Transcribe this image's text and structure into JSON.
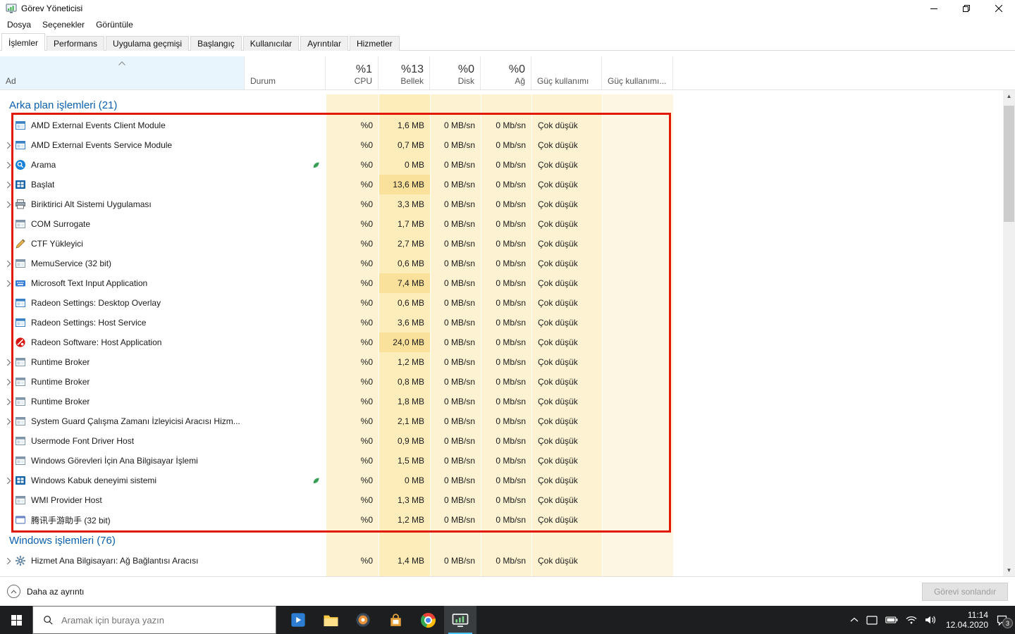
{
  "window": {
    "title": "Görev Yöneticisi"
  },
  "menu": [
    "Dosya",
    "Seçenekler",
    "Görüntüle"
  ],
  "tabs": [
    {
      "label": "İşlemler",
      "active": true
    },
    {
      "label": "Performans",
      "active": false
    },
    {
      "label": "Uygulama geçmişi",
      "active": false
    },
    {
      "label": "Başlangıç",
      "active": false
    },
    {
      "label": "Kullanıcılar",
      "active": false
    },
    {
      "label": "Ayrıntılar",
      "active": false
    },
    {
      "label": "Hizmetler",
      "active": false
    }
  ],
  "columns": {
    "name": {
      "label": "Ad",
      "sort": "asc"
    },
    "status": {
      "label": "Durum"
    },
    "cpu": {
      "total": "%1",
      "label": "CPU"
    },
    "memory": {
      "total": "%13",
      "label": "Bellek"
    },
    "disk": {
      "total": "%0",
      "label": "Disk"
    },
    "network": {
      "total": "%0",
      "label": "Ağ"
    },
    "power": {
      "label": "Güç kullanımı"
    },
    "power_trend": {
      "label": "Güç kullanımı..."
    }
  },
  "groups": {
    "background": "Arka plan işlemleri (21)",
    "windows": "Windows işlemleri (76)"
  },
  "background_processes": [
    {
      "icon": "app-window",
      "name": "AMD External Events Client Module",
      "cpu": "%0",
      "memory": "1,6 MB",
      "disk": "0 MB/sn",
      "network": "0 Mb/sn",
      "power": "Çok düşük",
      "expandable": false,
      "suspended": false
    },
    {
      "icon": "app-window",
      "name": "AMD External Events Service Module",
      "cpu": "%0",
      "memory": "0,7 MB",
      "disk": "0 MB/sn",
      "network": "0 Mb/sn",
      "power": "Çok düşük",
      "expandable": true,
      "suspended": false
    },
    {
      "icon": "search",
      "name": "Arama",
      "cpu": "%0",
      "memory": "0 MB",
      "disk": "0 MB/sn",
      "network": "0 Mb/sn",
      "power": "Çok düşük",
      "expandable": true,
      "suspended": true
    },
    {
      "icon": "start",
      "name": "Başlat",
      "cpu": "%0",
      "memory": "13,6 MB",
      "disk": "0 MB/sn",
      "network": "0 Mb/sn",
      "power": "Çok düşük",
      "expandable": true,
      "suspended": false
    },
    {
      "icon": "printer",
      "name": "Biriktirici Alt Sistemi Uygulaması",
      "cpu": "%0",
      "memory": "3,3 MB",
      "disk": "0 MB/sn",
      "network": "0 Mb/sn",
      "power": "Çok düşük",
      "expandable": true,
      "suspended": false
    },
    {
      "icon": "app-window-gray",
      "name": "COM Surrogate",
      "cpu": "%0",
      "memory": "1,7 MB",
      "disk": "0 MB/sn",
      "network": "0 Mb/sn",
      "power": "Çok düşük",
      "expandable": false,
      "suspended": false
    },
    {
      "icon": "pen",
      "name": "CTF Yükleyici",
      "cpu": "%0",
      "memory": "2,7 MB",
      "disk": "0 MB/sn",
      "network": "0 Mb/sn",
      "power": "Çok düşük",
      "expandable": false,
      "suspended": false
    },
    {
      "icon": "app-window-gray",
      "name": "MemuService (32 bit)",
      "cpu": "%0",
      "memory": "0,6 MB",
      "disk": "0 MB/sn",
      "network": "0 Mb/sn",
      "power": "Çok düşük",
      "expandable": true,
      "suspended": false
    },
    {
      "icon": "keyboard",
      "name": "Microsoft Text Input Application",
      "cpu": "%0",
      "memory": "7,4 MB",
      "disk": "0 MB/sn",
      "network": "0 Mb/sn",
      "power": "Çok düşük",
      "expandable": true,
      "suspended": false
    },
    {
      "icon": "app-window",
      "name": "Radeon Settings: Desktop Overlay",
      "cpu": "%0",
      "memory": "0,6 MB",
      "disk": "0 MB/sn",
      "network": "0 Mb/sn",
      "power": "Çok düşük",
      "expandable": false,
      "suspended": false
    },
    {
      "icon": "app-window",
      "name": "Radeon Settings: Host Service",
      "cpu": "%0",
      "memory": "3,6 MB",
      "disk": "0 MB/sn",
      "network": "0 Mb/sn",
      "power": "Çok düşük",
      "expandable": false,
      "suspended": false
    },
    {
      "icon": "radeon",
      "name": "Radeon Software: Host Application",
      "cpu": "%0",
      "memory": "24,0 MB",
      "disk": "0 MB/sn",
      "network": "0 Mb/sn",
      "power": "Çok düşük",
      "expandable": false,
      "suspended": false
    },
    {
      "icon": "app-window-gray",
      "name": "Runtime Broker",
      "cpu": "%0",
      "memory": "1,2 MB",
      "disk": "0 MB/sn",
      "network": "0 Mb/sn",
      "power": "Çok düşük",
      "expandable": true,
      "suspended": false
    },
    {
      "icon": "app-window-gray",
      "name": "Runtime Broker",
      "cpu": "%0",
      "memory": "0,8 MB",
      "disk": "0 MB/sn",
      "network": "0 Mb/sn",
      "power": "Çok düşük",
      "expandable": true,
      "suspended": false
    },
    {
      "icon": "app-window-gray",
      "name": "Runtime Broker",
      "cpu": "%0",
      "memory": "1,8 MB",
      "disk": "0 MB/sn",
      "network": "0 Mb/sn",
      "power": "Çok düşük",
      "expandable": true,
      "suspended": false
    },
    {
      "icon": "app-window-gray",
      "name": "System Guard Çalışma Zamanı İzleyicisi Aracısı Hizm...",
      "cpu": "%0",
      "memory": "2,1 MB",
      "disk": "0 MB/sn",
      "network": "0 Mb/sn",
      "power": "Çok düşük",
      "expandable": true,
      "suspended": false
    },
    {
      "icon": "app-window-gray",
      "name": "Usermode Font Driver Host",
      "cpu": "%0",
      "memory": "0,9 MB",
      "disk": "0 MB/sn",
      "network": "0 Mb/sn",
      "power": "Çok düşük",
      "expandable": false,
      "suspended": false
    },
    {
      "icon": "app-window-gray",
      "name": "Windows Görevleri İçin Ana Bilgisayar İşlemi",
      "cpu": "%0",
      "memory": "1,5 MB",
      "disk": "0 MB/sn",
      "network": "0 Mb/sn",
      "power": "Çok düşük",
      "expandable": false,
      "suspended": false
    },
    {
      "icon": "start",
      "name": "Windows Kabuk deneyimi sistemi",
      "cpu": "%0",
      "memory": "0 MB",
      "disk": "0 MB/sn",
      "network": "0 Mb/sn",
      "power": "Çok düşük",
      "expandable": true,
      "suspended": true
    },
    {
      "icon": "app-window-gray",
      "name": "WMI Provider Host",
      "cpu": "%0",
      "memory": "1,3 MB",
      "disk": "0 MB/sn",
      "network": "0 Mb/sn",
      "power": "Çok düşük",
      "expandable": false,
      "suspended": false
    },
    {
      "icon": "cn-app",
      "name": "腾讯手游助手 (32 bit)",
      "cpu": "%0",
      "memory": "1,2 MB",
      "disk": "0 MB/sn",
      "network": "0 Mb/sn",
      "power": "Çok düşük",
      "expandable": false,
      "suspended": false
    }
  ],
  "windows_processes": [
    {
      "icon": "gear",
      "name": "Hizmet Ana Bilgisayarı: Ağ Bağlantısı Aracısı",
      "cpu": "%0",
      "memory": "1,4 MB",
      "disk": "0 MB/sn",
      "network": "0 Mb/sn",
      "power": "Çok düşük",
      "expandable": true,
      "suspended": false
    }
  ],
  "footer": {
    "details_toggle": "Daha az ayrıntı",
    "end_task_button": "Görevi sonlandır"
  },
  "annotation": {
    "type": "rectangle",
    "color": "#e11900"
  },
  "taskbar": {
    "search_placeholder": "Aramak için buraya yazın",
    "apps": [
      {
        "name": "video-app",
        "active": false
      },
      {
        "name": "file-explorer",
        "active": false
      },
      {
        "name": "game-app",
        "active": false
      },
      {
        "name": "store-app",
        "active": false
      },
      {
        "name": "chrome",
        "active": false
      },
      {
        "name": "task-manager",
        "active": true
      }
    ],
    "tray": {
      "time": "11:14",
      "date": "12.04.2020",
      "notification_count": "3"
    }
  }
}
